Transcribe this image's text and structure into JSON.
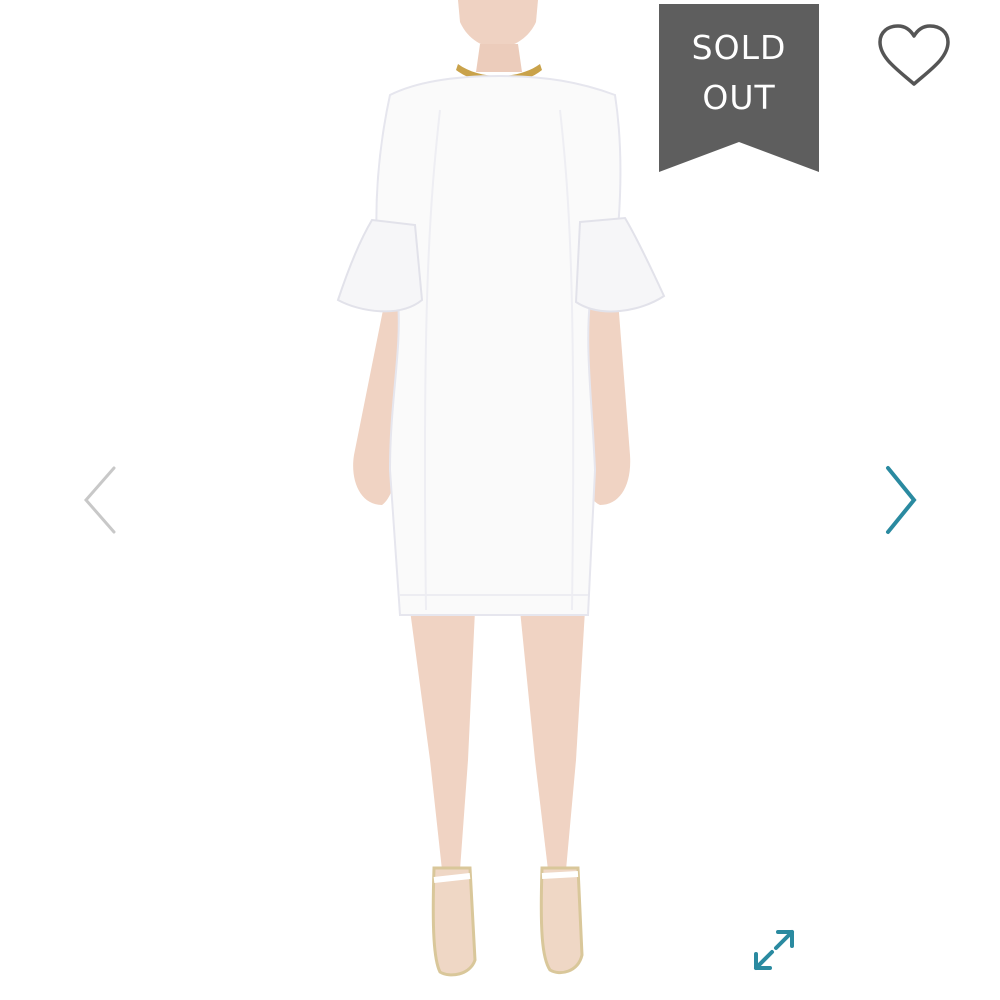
{
  "badge": {
    "line1": "SOLD",
    "line2": "OUT",
    "color": "#5e5e5e"
  },
  "icons": {
    "favorite": "heart-outline-icon",
    "previous": "chevron-left-icon",
    "next": "chevron-right-icon",
    "expand": "expand-arrows-icon"
  },
  "colors": {
    "accent": "#2a8aa0",
    "muted_chevron": "#c8c8c8",
    "heart_stroke": "#555555"
  }
}
